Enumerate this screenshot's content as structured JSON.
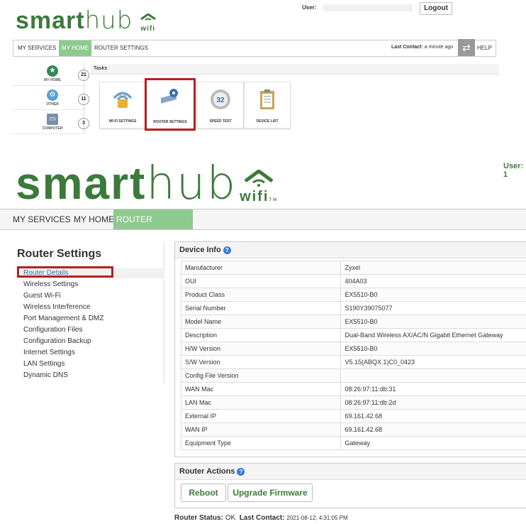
{
  "header_small": {
    "logo_bold": "smart",
    "logo_thin": "hub",
    "logo_wifi": "wifi",
    "user_label": "User:",
    "logout_label": "Logout",
    "nav": [
      "MY SERVICES",
      "MY HOME",
      "ROUTER SETTINGS"
    ],
    "last_contact_label": "Last Contact:",
    "last_contact_value": "a minute ago",
    "help_label": "HELP"
  },
  "sidebar_small": [
    {
      "label": "MY HOME",
      "count": "21",
      "icon": "star-icon",
      "color": "#2e8b57"
    },
    {
      "label": "OTHER",
      "count": "11",
      "icon": "gear-icon",
      "color": "#5aa0d8"
    },
    {
      "label": "COMPUTER",
      "count": "3",
      "icon": "laptop-icon",
      "color": "#7a8fa8"
    }
  ],
  "tasks": {
    "heading": "Tasks",
    "tiles": [
      {
        "label": "WI-FI SETTINGS",
        "icon": "lock-icon",
        "glyph": "🔒"
      },
      {
        "label": "ROUTER SETTINGS",
        "icon": "router-icon",
        "glyph": "⚙"
      },
      {
        "label": "SPEED TEST",
        "icon": "speedometer-icon",
        "glyph": "32"
      },
      {
        "label": "DEVICE LIST",
        "icon": "clipboard-icon",
        "glyph": "📋"
      }
    ]
  },
  "header_big": {
    "logo_bold": "smart",
    "logo_thin": "hub",
    "logo_wifi": "wifi",
    "tm": "TM",
    "user_label": "User: 1",
    "nav": [
      "MY SERVICES",
      "MY HOME",
      "ROUTER SETTINGS"
    ]
  },
  "router_settings": {
    "title": "Router Settings",
    "menu": [
      "Router Details",
      "Wireless Settings",
      "Guest Wi-Fi",
      "Wireless Interference",
      "Port Management & DMZ",
      "Configuration Files",
      "Configuration Backup",
      "Internet Settings",
      "LAN Settings",
      "Dynamic DNS"
    ]
  },
  "device_info": {
    "title": "Device Info",
    "rows": [
      [
        "Manufacturer",
        "Zyxel"
      ],
      [
        "OUI",
        "404A03"
      ],
      [
        "Product Class",
        "EX5510-B0"
      ],
      [
        "Serial Number",
        "S190Y39075077"
      ],
      [
        "Model Name",
        "EX5510-B0"
      ],
      [
        "Description",
        "Dual-Band Wireless AX/AC/N Gigabit Ethernet Gateway"
      ],
      [
        "H/W Version",
        "EX5510-B0"
      ],
      [
        "S/W Version",
        "V5.15(ABQX.1)C0_0423"
      ],
      [
        "Config File Version",
        ""
      ],
      [
        "WAN Mac",
        "08:26:97:11:db:31"
      ],
      [
        "LAN Mac",
        "08:26:97:11:db:2d"
      ],
      [
        "External IP",
        "69.161.42.68"
      ],
      [
        "WAN IP",
        "69.161.42.68"
      ],
      [
        "Equipment Type",
        "Gateway"
      ]
    ]
  },
  "router_actions": {
    "title": "Router Actions",
    "reboot_label": "Reboot",
    "upgrade_label": "Upgrade Firmware"
  },
  "status": {
    "status_label": "Router Status:",
    "status_value": "OK",
    "last_contact_label": "Last Contact:",
    "last_contact_value": "2021-08-12, 4:31:05 PM"
  },
  "colors": {
    "brand_green": "#3c7a3c",
    "nav_active": "#8ec98e",
    "highlight": "#b22222",
    "link_blue": "#2a6fb0"
  }
}
